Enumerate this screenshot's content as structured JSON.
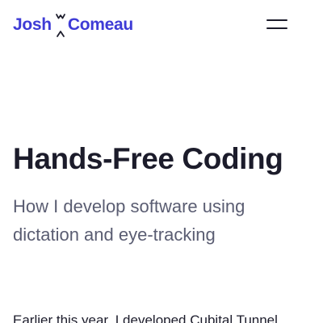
{
  "header": {
    "logo": {
      "first": "Josh",
      "last": "Comeau",
      "mark_icon": "sparkle-mark-icon",
      "color": "#3e3bd6"
    },
    "menu_icon": "hamburger-menu-icon"
  },
  "article": {
    "title": "Hands-Free Coding",
    "subtitle": "How I develop software using dictation and eye-tracking",
    "intro": "Earlier this year, I developed Cubital Tunnel"
  },
  "colors": {
    "text": "#1c1c2b",
    "subtitle": "#5a5d72",
    "background": "#ffffff"
  }
}
